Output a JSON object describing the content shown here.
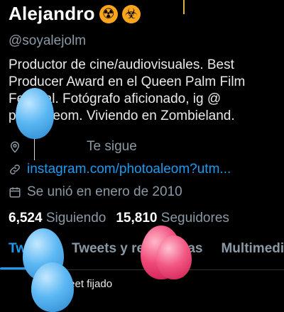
{
  "profile": {
    "name": "Alejandro",
    "badges": [
      "☢",
      "☣"
    ],
    "handle": "@soyalejolm",
    "bio": "Productor de cine/audiovisuales. Best Producer Award en el Queen Palm Film Festival. Fotógrafo aficionado, ig @ photoaleom. Viviendo en Zombieland.",
    "follows_you": "Te sigue",
    "website": "instagram.com/photoaleom?utm...",
    "joined": "Se unió en enero de 2010",
    "following_count": "6,524",
    "following_label": "Siguiendo",
    "followers_count": "15,810",
    "followers_label": "Seguidores"
  },
  "tabs": [
    {
      "label": "Tweets",
      "active": true
    },
    {
      "label": "Tweets y respuestas",
      "active": false
    },
    {
      "label": "Multimedia",
      "active": false
    }
  ],
  "footer": {
    "peek_text": "Tweet fijado"
  },
  "colors": {
    "accent": "#1d9bf0",
    "muted": "#8b98a5",
    "badge": "#f7a51c"
  },
  "icons": [
    "location-pin-icon",
    "link-icon",
    "calendar-icon"
  ]
}
